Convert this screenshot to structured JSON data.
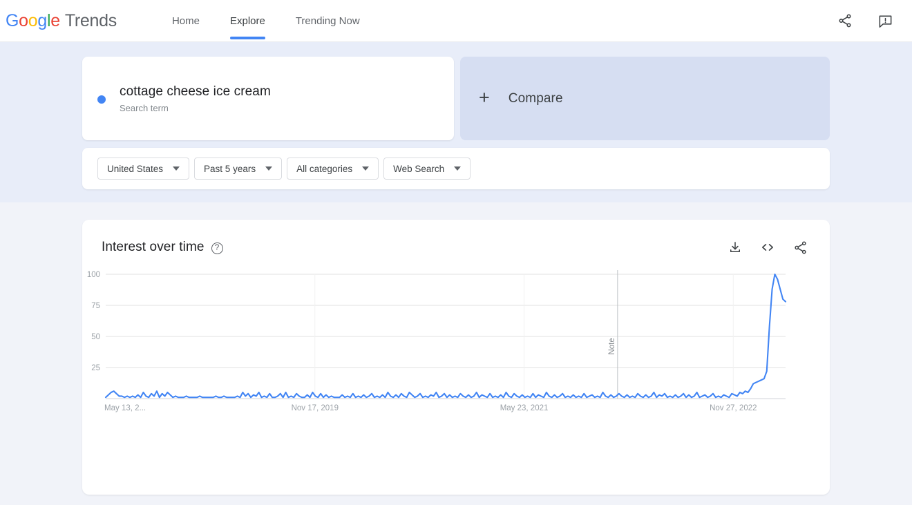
{
  "header": {
    "logo_word": "Google",
    "logo_suffix": "Trends",
    "nav": [
      {
        "label": "Home",
        "active": false
      },
      {
        "label": "Explore",
        "active": true
      },
      {
        "label": "Trending Now",
        "active": false
      }
    ],
    "actions": [
      {
        "name": "share-icon",
        "label": "Share"
      },
      {
        "name": "feedback-icon",
        "label": "Send feedback"
      }
    ]
  },
  "search": {
    "term": "cottage cheese ice cream",
    "type_label": "Search term",
    "dot_color": "#4285F4"
  },
  "compare": {
    "label": "Compare",
    "plus": "+"
  },
  "filters": [
    {
      "name": "region-filter",
      "value": "United States"
    },
    {
      "name": "time-filter",
      "value": "Past 5 years"
    },
    {
      "name": "category-filter",
      "value": "All categories"
    },
    {
      "name": "search-type-filter",
      "value": "Web Search"
    }
  ],
  "chart_panel": {
    "title": "Interest over time",
    "help_glyph": "?",
    "actions": [
      {
        "name": "download-icon",
        "label": "Download CSV"
      },
      {
        "name": "embed-code-icon",
        "label": "Embed"
      },
      {
        "name": "share-icon",
        "label": "Share"
      }
    ]
  },
  "chart_data": {
    "type": "line",
    "title": "Interest over time",
    "xlabel": "",
    "ylabel": "",
    "ylim": [
      0,
      100
    ],
    "yticks": [
      100,
      75,
      50,
      25
    ],
    "grid": true,
    "legend": false,
    "line_color": "#4285F4",
    "xticks": [
      "May 13, 2...",
      "Nov 17, 2019",
      "May 23, 2021",
      "Nov 27, 2022"
    ],
    "xtick_positions": [
      0,
      0.3077,
      0.6154,
      0.9231
    ],
    "annotations": [
      {
        "name": "note-marker",
        "label": "Note",
        "x_fraction": 0.7529
      }
    ],
    "series": [
      {
        "name": "cottage cheese ice cream",
        "color": "#4285F4",
        "values": [
          1,
          3,
          5,
          6,
          4,
          2,
          2,
          1,
          2,
          1,
          2,
          1,
          3,
          1,
          5,
          2,
          1,
          4,
          2,
          6,
          1,
          4,
          2,
          5,
          3,
          1,
          2,
          1,
          1,
          1,
          2,
          1,
          1,
          1,
          1,
          2,
          1,
          1,
          1,
          1,
          1,
          2,
          1,
          1,
          2,
          1,
          1,
          1,
          1,
          2,
          1,
          5,
          2,
          4,
          1,
          3,
          2,
          5,
          1,
          2,
          1,
          4,
          1,
          1,
          2,
          4,
          1,
          5,
          1,
          2,
          1,
          4,
          2,
          1,
          1,
          3,
          1,
          5,
          2,
          1,
          4,
          1,
          3,
          1,
          2,
          1,
          1,
          1,
          3,
          1,
          2,
          1,
          4,
          1,
          2,
          1,
          3,
          1,
          2,
          4,
          1,
          2,
          1,
          3,
          1,
          5,
          2,
          1,
          3,
          1,
          4,
          2,
          1,
          5,
          3,
          1,
          2,
          4,
          1,
          2,
          1,
          3,
          2,
          5,
          1,
          2,
          4,
          1,
          3,
          1,
          2,
          1,
          4,
          2,
          1,
          3,
          1,
          2,
          5,
          1,
          3,
          2,
          1,
          4,
          1,
          2,
          1,
          3,
          1,
          5,
          2,
          1,
          4,
          2,
          1,
          3,
          1,
          2,
          1,
          4,
          1,
          3,
          2,
          1,
          5,
          2,
          1,
          3,
          1,
          2,
          4,
          1,
          2,
          1,
          3,
          1,
          2,
          1,
          4,
          1,
          2,
          3,
          1,
          2,
          1,
          5,
          2,
          1,
          3,
          1,
          2,
          4,
          2,
          1,
          3,
          1,
          2,
          1,
          4,
          2,
          1,
          3,
          1,
          2,
          5,
          1,
          3,
          2,
          4,
          1,
          2,
          1,
          3,
          1,
          2,
          4,
          1,
          3,
          1,
          2,
          5,
          1,
          2,
          3,
          1,
          2,
          4,
          1,
          2,
          1,
          3,
          2,
          1,
          4,
          3,
          2,
          5,
          4,
          6,
          5,
          8,
          12,
          13,
          14,
          15,
          16,
          22,
          58,
          88,
          100,
          96,
          88,
          80,
          78
        ],
        "peak_value": 100,
        "last_value": 78,
        "baseline_range": [
          1,
          6
        ]
      }
    ]
  }
}
